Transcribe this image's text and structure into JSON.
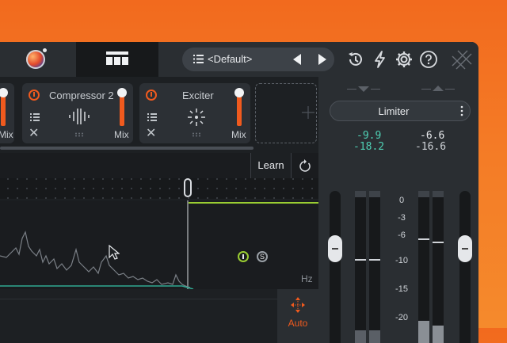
{
  "topbar": {
    "preset_name": "<Default>",
    "icons": [
      "plugin-logo-icon",
      "module-view-icon",
      "list-icon",
      "previous-arrow-icon",
      "next-arrow-icon",
      "history-icon",
      "lightning-icon",
      "gear-icon",
      "help-icon",
      "izotope-logo-icon"
    ]
  },
  "modules": [
    {
      "title": "",
      "mix_label": "Mix"
    },
    {
      "title": "Compressor 2",
      "mix_label": "Mix"
    },
    {
      "title": "Exciter",
      "mix_label": "Mix"
    }
  ],
  "learn": {
    "label": "Learn"
  },
  "spectrum": {
    "hz_label": "Hz"
  },
  "auto": {
    "label": "Auto"
  },
  "limiter": {
    "label": "Limiter",
    "in_peak_a": "-9.9",
    "in_peak_b": "-18.2",
    "out_peak_a": "-6.6",
    "out_peak_b": "-16.6",
    "scale": [
      "0",
      "-3",
      "-6",
      "-10",
      "-15",
      "-20"
    ]
  },
  "colors": {
    "accent": "#f05a1e",
    "teal": "#4fd1b5",
    "green": "#9acd32"
  }
}
